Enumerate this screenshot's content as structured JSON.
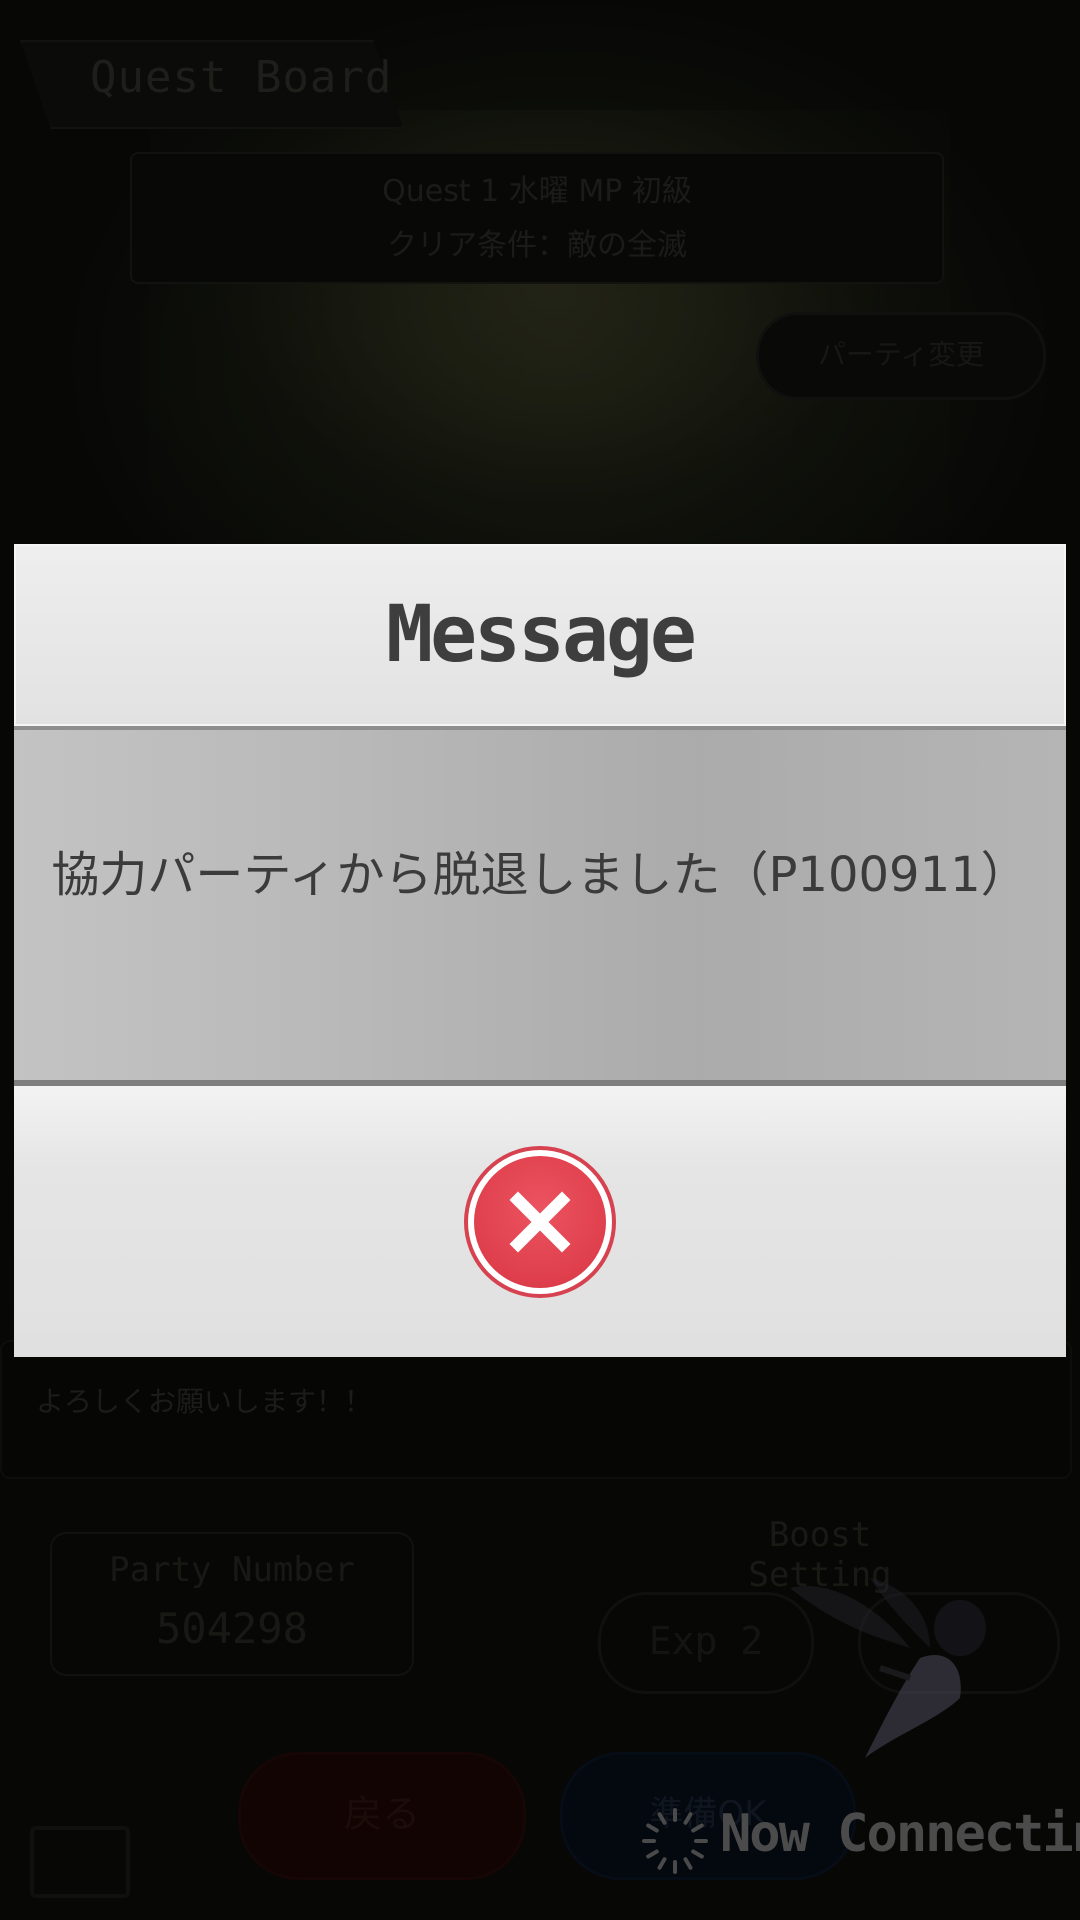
{
  "background": {
    "header_title": "Quest Board",
    "quest_line1": "Quest 1 水曜 MP 初級",
    "quest_line2": "クリア条件：敵の全滅",
    "party_edit_label": "パーティ変更",
    "comment_text": "よろしくお願いします！！",
    "party_number_label": "Party Number",
    "party_number_value": "504298",
    "boost_setting_title": "Boost Setting",
    "boost_option_label": "Exp 2",
    "back_label": "戻る",
    "ready_label": "準備OK"
  },
  "modal": {
    "title": "Message",
    "message": "協力パーティから脱退しました（P100911）",
    "close_icon": "close-x-icon",
    "accent_color": "#df3f4c"
  },
  "status": {
    "connecting_text": "Now Connecting"
  }
}
